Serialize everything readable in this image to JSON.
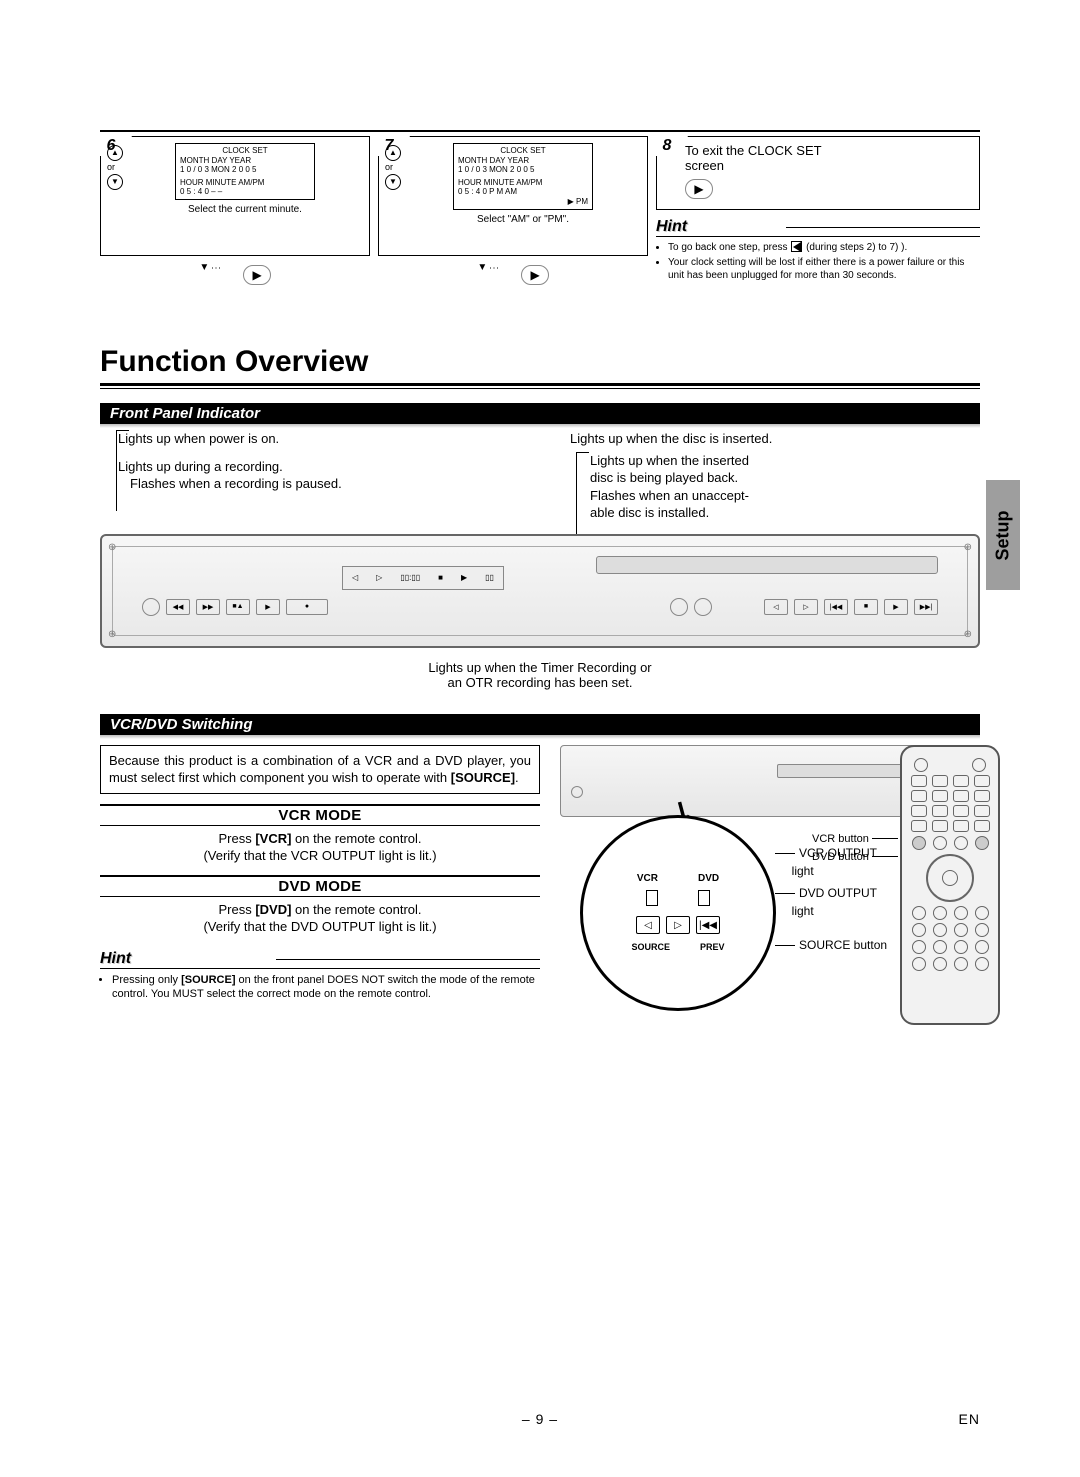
{
  "steps": {
    "s6": {
      "num": "6",
      "or": "or",
      "screen": {
        "title": "CLOCK SET",
        "l1": "MONTH  DAY        YEAR",
        "l2": "1 0   /   0 3  MON   2 0 0 5",
        "l3": "HOUR  MINUTE      AM/PM",
        "l4": "0 5   :  4 0         – –"
      },
      "caption": "Select the current minute."
    },
    "s7": {
      "num": "7",
      "or": "or",
      "screen": {
        "title": "CLOCK SET",
        "l1": "MONTH  DAY        YEAR",
        "l2": "1 0   /   0 3  MON   2 0 0 5",
        "l3": "HOUR  MINUTE      AM/PM",
        "l4": "0 5   :   4 0        P M  AM",
        "l5": "▶ PM"
      },
      "caption": "Select \"AM\" or \"PM\"."
    },
    "s8": {
      "num": "8",
      "text1": "To exit the CLOCK SET",
      "text2": "screen"
    }
  },
  "hint1": {
    "title": "Hint",
    "items": [
      "To go back one step, press [◀] (during steps 2) to 7) ).",
      "Your clock setting will be lost if either there is a power failure or this unit has been unplugged for more than 30 seconds."
    ]
  },
  "h1": "Function Overview",
  "side_tab": "Setup",
  "front_panel": {
    "head": "Front Panel Indicator",
    "l_power": "Lights up when power is on.",
    "l_rec1": "Lights up during a recording.",
    "l_rec2": "Flashes when a recording is paused.",
    "r_disc": "Lights up when the disc is inserted.",
    "r_play1": "Lights up when the inserted",
    "r_play2": "disc is being played back.",
    "r_play3": "Flashes when an unaccept-",
    "r_play4": "able disc is installed.",
    "below1": "Lights up when the Timer Recording or",
    "below2": "an OTR recording has been set."
  },
  "switching": {
    "head": "VCR/DVD Switching",
    "intro": "Because this product is a combination of a VCR and a DVD player, you must select first which component you wish to operate with ",
    "intro_bold": "[SOURCE]",
    "intro_end": ".",
    "vcr_head": "VCR MODE",
    "vcr_l1a": "Press ",
    "vcr_l1b": "[VCR]",
    "vcr_l1c": " on the remote control.",
    "vcr_l2": "(Verify that the VCR OUTPUT light is lit.)",
    "dvd_head": "DVD MODE",
    "dvd_l1a": "Press ",
    "dvd_l1b": "[DVD]",
    "dvd_l1c": " on the remote control.",
    "dvd_l2": "(Verify that the DVD OUTPUT light is lit.)"
  },
  "hint2": {
    "title": "Hint",
    "item_a": "Pressing only ",
    "item_b": "[SOURCE]",
    "item_c": " on the front panel DOES NOT switch the mode of the remote control. You MUST select the correct mode on the remote control."
  },
  "callouts": {
    "vcr_btn": "VCR button",
    "dvd_btn": "DVD button",
    "vcr_out1": "VCR OUTPUT",
    "vcr_out2": "light",
    "dvd_out1": "DVD OUTPUT",
    "dvd_out2": "light",
    "source_btn": "SOURCE button"
  },
  "zoom": {
    "vcr": "VCR",
    "dvd": "DVD",
    "source": "SOURCE",
    "prev": "PREV"
  },
  "footer": {
    "page": "– 9 –",
    "lang": "EN"
  }
}
